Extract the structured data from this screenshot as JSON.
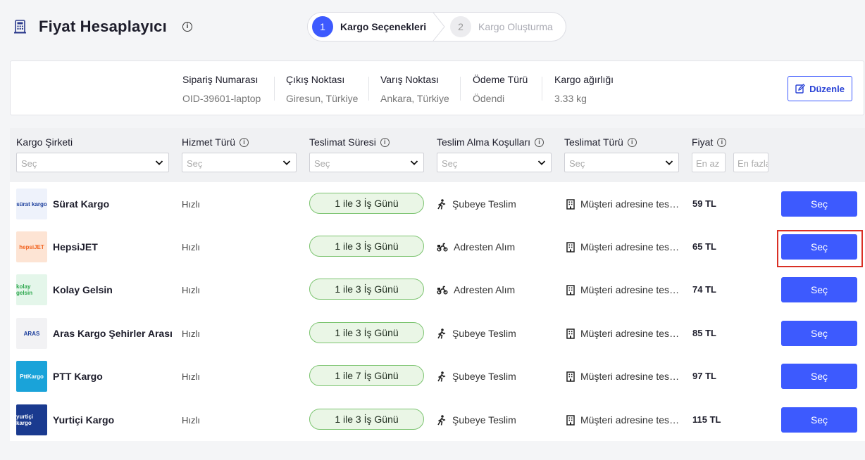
{
  "header": {
    "title": "Fiyat Hesaplayıcı",
    "info_glyph": "i"
  },
  "stepper": {
    "steps": [
      {
        "num": "1",
        "label": "Kargo Seçenekleri"
      },
      {
        "num": "2",
        "label": "Kargo Oluşturma"
      }
    ],
    "active_color": "#3d5afe"
  },
  "summary": {
    "fields": [
      {
        "key": "Sipariş Numarası",
        "value": "OID-39601-laptop"
      },
      {
        "key": "Çıkış Noktası",
        "value": "Giresun, Türkiye"
      },
      {
        "key": "Varış Noktası",
        "value": "Ankara, Türkiye"
      },
      {
        "key": "Ödeme Türü",
        "value": "Ödendi"
      },
      {
        "key": "Kargo ağırlığı",
        "value": "3.33 kg"
      }
    ],
    "edit_label": "Düzenle"
  },
  "table": {
    "columns": [
      "Kargo Şirketi",
      "Hizmet Türü",
      "Teslimat Süresi",
      "Teslim Alma Koşulları",
      "Teslimat Türü",
      "Fiyat"
    ],
    "select_placeholder": "Seç",
    "price_min_placeholder": "En az",
    "price_max_placeholder": "En fazla",
    "rows": [
      {
        "company": "Sürat Kargo",
        "logo_text": "sürat kargo",
        "service": "Hızlı",
        "duration": "1 ile 3 İş Günü",
        "pickup": "Şubeye Teslim",
        "pickup_icon": "walking-person-icon",
        "delivery": "Müşteri adresine teslimat",
        "price": "59 TL",
        "action": "Seç"
      },
      {
        "company": "HepsiJET",
        "logo_text": "hepsiJET",
        "service": "Hızlı",
        "duration": "1 ile 3 İş Günü",
        "pickup": "Adresten Alım",
        "pickup_icon": "courier-scooter-icon",
        "delivery": "Müşteri adresine teslimat",
        "price": "65 TL",
        "action": "Seç"
      },
      {
        "company": "Kolay Gelsin",
        "logo_text": "kolay gelsin",
        "service": "Hızlı",
        "duration": "1 ile 3 İş Günü",
        "pickup": "Adresten Alım",
        "pickup_icon": "courier-scooter-icon",
        "delivery": "Müşteri adresine teslimat",
        "price": "74 TL",
        "action": "Seç"
      },
      {
        "company": "Aras Kargo Şehirler Arası",
        "logo_text": "ARAS",
        "service": "Hızlı",
        "duration": "1 ile 3 İş Günü",
        "pickup": "Şubeye Teslim",
        "pickup_icon": "walking-person-icon",
        "delivery": "Müşteri adresine teslimat",
        "price": "85 TL",
        "action": "Seç"
      },
      {
        "company": "PTT Kargo",
        "logo_text": "PttKargo",
        "service": "Hızlı",
        "duration": "1 ile 7 İş Günü",
        "pickup": "Şubeye Teslim",
        "pickup_icon": "walking-person-icon",
        "delivery": "Müşteri adresine teslimat",
        "price": "97 TL",
        "action": "Seç"
      },
      {
        "company": "Yurtiçi Kargo",
        "logo_text": "yurtiçi kargo",
        "service": "Hızlı",
        "duration": "1 ile 3 İş Günü",
        "pickup": "Şubeye Teslim",
        "pickup_icon": "walking-person-icon",
        "delivery": "Müşteri adresine teslimat",
        "price": "115 TL",
        "action": "Seç"
      }
    ]
  },
  "colors": {
    "primary": "#3d5afe",
    "pill_bg": "#eaf6e6",
    "pill_border": "#7cc470",
    "highlight": "#d93025"
  }
}
